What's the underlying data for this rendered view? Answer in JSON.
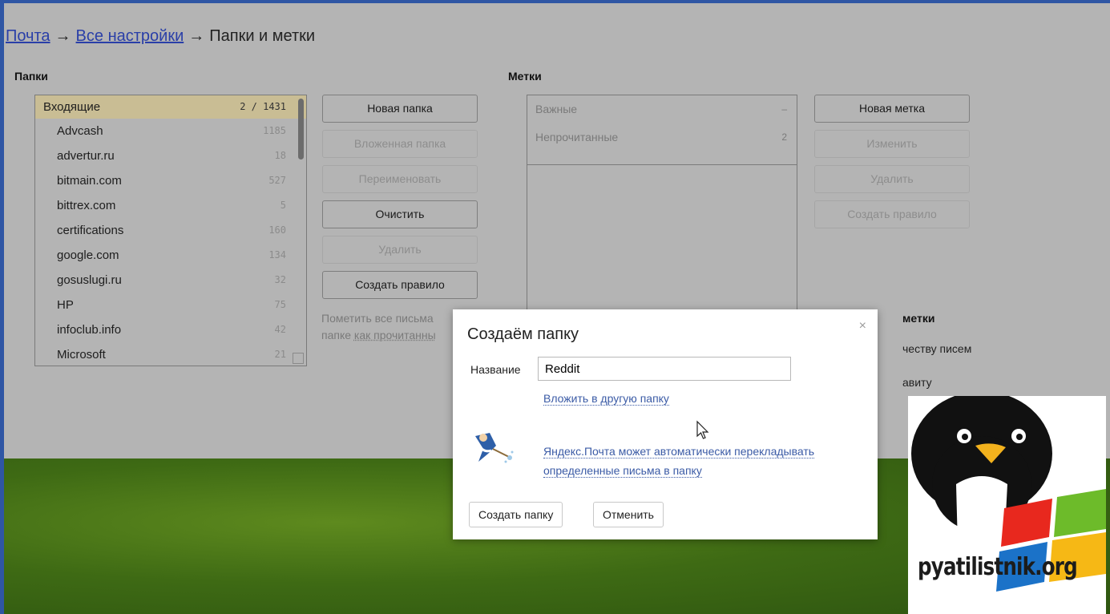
{
  "breadcrumb": {
    "link1": "Почта",
    "arrow": "→",
    "link2": "Все настройки",
    "current": "Папки и метки"
  },
  "folders": {
    "title": "Папки",
    "items": [
      {
        "name": "Входящие",
        "count": "2 / 1431",
        "active": true
      },
      {
        "name": "Advcash",
        "count": "1185"
      },
      {
        "name": "advertur.ru",
        "count": "18"
      },
      {
        "name": "bitmain.com",
        "count": "527"
      },
      {
        "name": "bittrex.com",
        "count": "5"
      },
      {
        "name": "certifications",
        "count": "160"
      },
      {
        "name": "google.com",
        "count": "134"
      },
      {
        "name": "gosuslugi.ru",
        "count": "32"
      },
      {
        "name": "HP",
        "count": "75"
      },
      {
        "name": "infoclub.info",
        "count": "42"
      },
      {
        "name": "Microsoft",
        "count": "21"
      }
    ]
  },
  "folder_actions": {
    "new_folder": "Новая папка",
    "subfolder": "Вложенная папка",
    "rename": "Переименовать",
    "clear": "Очистить",
    "delete": "Удалить",
    "create_rule": "Создать правило",
    "mark_read_line1": "Пометить все письма",
    "mark_read_prefix": "папке ",
    "mark_read_link": "как прочитанны"
  },
  "labels": {
    "title": "Метки",
    "items": [
      {
        "name": "Важные",
        "count": "–"
      },
      {
        "name": "Непрочитанные",
        "count": "2"
      }
    ]
  },
  "label_actions": {
    "new_label": "Новая метка",
    "edit": "Изменить",
    "delete": "Удалить",
    "create_rule": "Создать правило"
  },
  "sort": {
    "title": "метки",
    "opt1": "честву писем",
    "opt2": "авиту"
  },
  "dialog": {
    "title": "Создаём папку",
    "close": "×",
    "name_label": "Название",
    "name_value": "Reddit",
    "nest_link": "Вложить в другую папку",
    "promo_line1": "Яндекс.Почта может автоматически перекладывать",
    "promo_line2": "определенные письма в папку",
    "create_button": "Создать папку",
    "cancel_button": "Отменить"
  },
  "watermark": {
    "text": "pyatilistnik.org"
  },
  "colors": {
    "overlay": "#b4b4b4",
    "active_folder": "#c9bd94",
    "link": "#2a3fa8",
    "dialog_link": "#3b5ba6",
    "frame": "#2f56a4"
  }
}
